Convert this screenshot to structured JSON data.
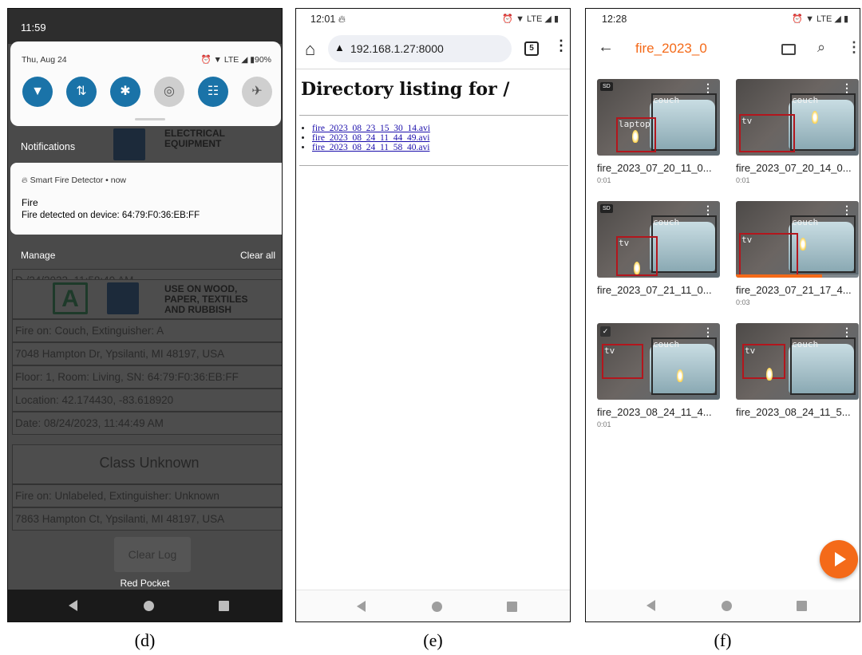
{
  "phone_d": {
    "status_time": "11:59",
    "quick_settings": {
      "date": "Thu, Aug 24",
      "status_icons": "⏰ ▼ LTE ◢ ▮90%",
      "tiles": [
        {
          "icon": "wifi-icon",
          "glyph": "▼"
        },
        {
          "icon": "data-icon",
          "glyph": "⇅"
        },
        {
          "icon": "bluetooth-icon",
          "glyph": "✱"
        },
        {
          "icon": "hotspot-icon",
          "glyph": "◎"
        },
        {
          "icon": "equalizer-icon",
          "glyph": "☷"
        },
        {
          "icon": "airplane-icon",
          "glyph": "✈"
        }
      ]
    },
    "notifications_label": "Notifications",
    "notification": {
      "app": "Smart Fire Detector • now",
      "title": "Fire",
      "text": "Fire detected on device: 64:79:F0:36:EB:FF"
    },
    "manage": "Manage",
    "date_fragment": "D      /24/2023, 11:58:40 AM",
    "clear_all": "Clear all",
    "sign_top_text": "ELECTRICAL\nEQUIPMENT",
    "sign_a_letter": "A",
    "sign_a_text": "USE ON WOOD,\nPAPER, TEXTILES\nAND RUBBISH",
    "log_rows_a": [
      "Fire on:  Couch, Extinguisher: A",
      "7048 Hampton Dr, Ypsilanti, MI 48197, USA",
      "Floor: 1,  Room: Living, SN: 64:79:F0:36:EB:FF",
      "Location: 42.174430, -83.618920",
      "Date: 08/24/2023, 11:44:49 AM"
    ],
    "class_unknown": "Class Unknown",
    "log_rows_unknown": [
      "Fire on:  Unlabeled, Extinguisher: Unknown",
      "7863 Hampton Ct, Ypsilanti, MI 48197, USA"
    ],
    "clear_log": "Clear Log",
    "carrier": "Red Pocket"
  },
  "phone_e": {
    "status_time": "12:01",
    "status_icons": "⏰ ▼ LTE ◢ ▮",
    "url": "192.168.1.27:8000",
    "tab_count": "5",
    "heading": "Directory listing for /",
    "files": [
      "fire_2023_08_23_15_30_14.avi",
      "fire_2023_08_24_11_44_49.avi",
      "fire_2023_08_24_11_58_40.avi"
    ]
  },
  "phone_f": {
    "status_time": "12:28",
    "status_icons": "⏰ ▼ LTE ◢ ▮",
    "folder_title": "fire_2023_0",
    "videos": [
      {
        "name": "fire_2023_07_20_11_0...",
        "duration": "0:01",
        "badge": "SD",
        "labels": [
          "couch",
          "laptop"
        ],
        "progress": 0
      },
      {
        "name": "fire_2023_07_20_14_0...",
        "duration": "0:01",
        "badge": "",
        "labels": [
          "couch",
          "tv"
        ],
        "progress": 0
      },
      {
        "name": "fire_2023_07_21_11_0...",
        "duration": "",
        "badge": "SD",
        "labels": [
          "couch",
          "tv"
        ],
        "progress": 0
      },
      {
        "name": "fire_2023_07_21_17_4...",
        "duration": "0:03",
        "badge": "",
        "labels": [
          "couch",
          "tv"
        ],
        "progress": 0.7
      },
      {
        "name": "fire_2023_08_24_11_4...",
        "duration": "0:01",
        "badge": "✓",
        "labels": [
          "couch",
          "tv"
        ],
        "progress": 0
      },
      {
        "name": "fire_2023_08_24_11_5...",
        "duration": "",
        "badge": "",
        "labels": [
          "couch",
          "tv"
        ],
        "progress": 0
      }
    ]
  },
  "captions": {
    "d": "(d)",
    "e": "(e)",
    "f": "(f)"
  },
  "colors": {
    "accent_orange": "#f46a19",
    "tile_blue": "#1a73a8",
    "link_blue": "#1a0dab"
  }
}
